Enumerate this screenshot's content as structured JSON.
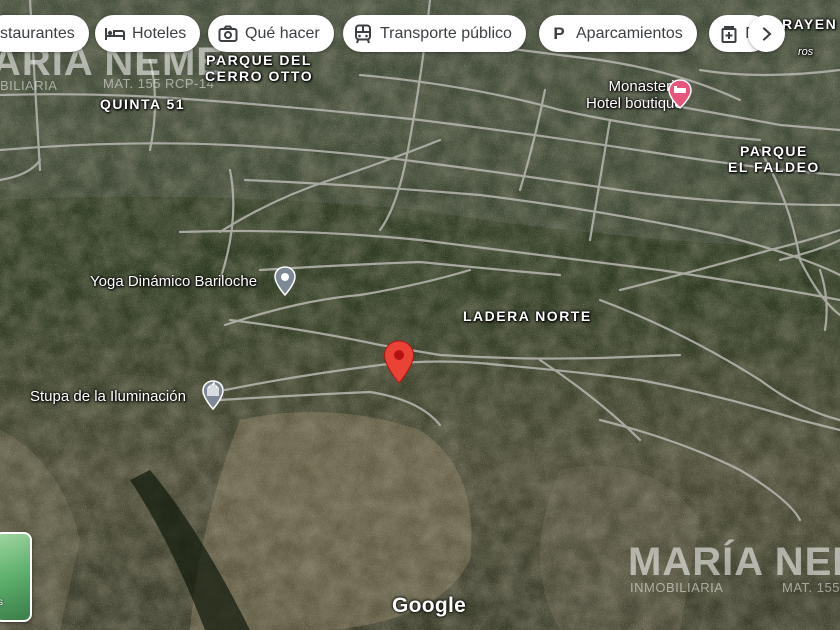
{
  "chips": [
    {
      "label": "staurantes",
      "icon": "restaurant-icon"
    },
    {
      "label": "Hoteles",
      "icon": "bed-icon"
    },
    {
      "label": "Qué hacer",
      "icon": "camera-icon"
    },
    {
      "label": "Transporte público",
      "icon": "transit-icon"
    },
    {
      "label": "Aparcamientos",
      "icon": "parking-icon"
    },
    {
      "label": "F",
      "icon": "pharmacy-icon"
    }
  ],
  "chip_next_icon": "chevron-right-icon",
  "areas": {
    "parque_cerro_otto_l1": "PARQUE DEL",
    "parque_cerro_otto_l2": "CERRO OTTO",
    "quinta_51": "QUINTA 51",
    "parque_faldeo_l1": "PARQUE",
    "parque_faldeo_l2": "EL FALDEO",
    "ladera_norte": "LADERA NORTE",
    "rayen": "RAYEN",
    "ros": "ros"
  },
  "pois": {
    "monasterio_l1": "Monasterio",
    "monasterio_l2": "Hotel boutique",
    "yoga": "Yoga Dinámico Bariloche",
    "stupa": "Stupa de la Iluminación"
  },
  "watermark": {
    "top_name": "ARIA NEME",
    "top_sub": "BILIARIA",
    "top_mat": "MAT. 155 RCP-14",
    "bottom_name": "MARÍA NEME",
    "bottom_sub": "INMOBILIARIA",
    "bottom_mat": "MAT. 155"
  },
  "attribution": "Google",
  "layers_label": "s",
  "colors": {
    "pin_red": "#ea4335",
    "hotel_pink": "#e8557c",
    "poi_gray": "#7d8a96"
  }
}
